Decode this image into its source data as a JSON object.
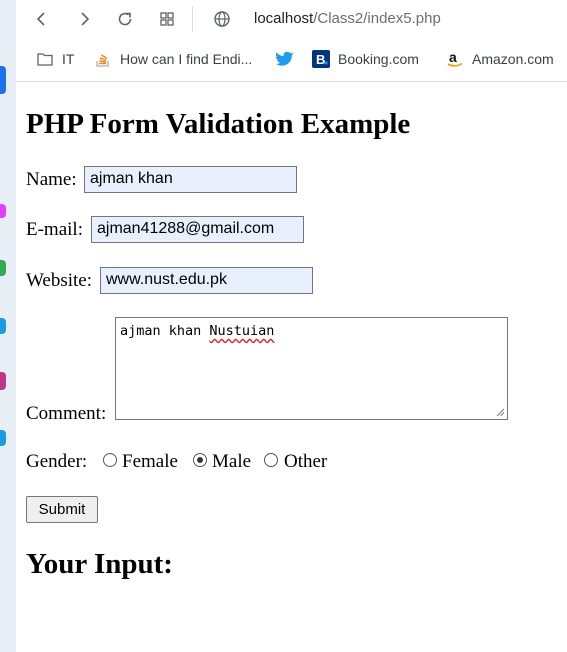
{
  "browser": {
    "url_host": "localhost",
    "url_path": "/Class2/index5.php",
    "bookmarks": [
      {
        "label": "IT",
        "icon": "folder-icon"
      },
      {
        "label": "How can I find Endi...",
        "icon": "stackoverflow-icon"
      },
      {
        "label": "",
        "icon": "twitter-icon"
      },
      {
        "label": "Booking.com",
        "icon": "booking-icon"
      },
      {
        "label": "Amazon.com",
        "icon": "amazon-icon"
      }
    ]
  },
  "page": {
    "title": "PHP Form Validation Example",
    "result_heading": "Your Input:"
  },
  "form": {
    "name_label": "Name:",
    "name_value": "ajman khan",
    "email_label": "E-mail:",
    "email_value": "ajman41288@gmail.com",
    "website_label": "Website:",
    "website_value": "www.nust.edu.pk",
    "comment_label": "Comment:",
    "comment_value_plain": "ajman khan ",
    "comment_value_misspelled": "Nustuian",
    "gender_label": "Gender:",
    "gender_options": [
      "Female",
      "Male",
      "Other"
    ],
    "gender_selected": "Male",
    "submit_label": "Submit"
  },
  "colors": {
    "autofill_bg": "#e8f0fe",
    "twitter": "#1d9bf0",
    "booking": "#003580"
  }
}
